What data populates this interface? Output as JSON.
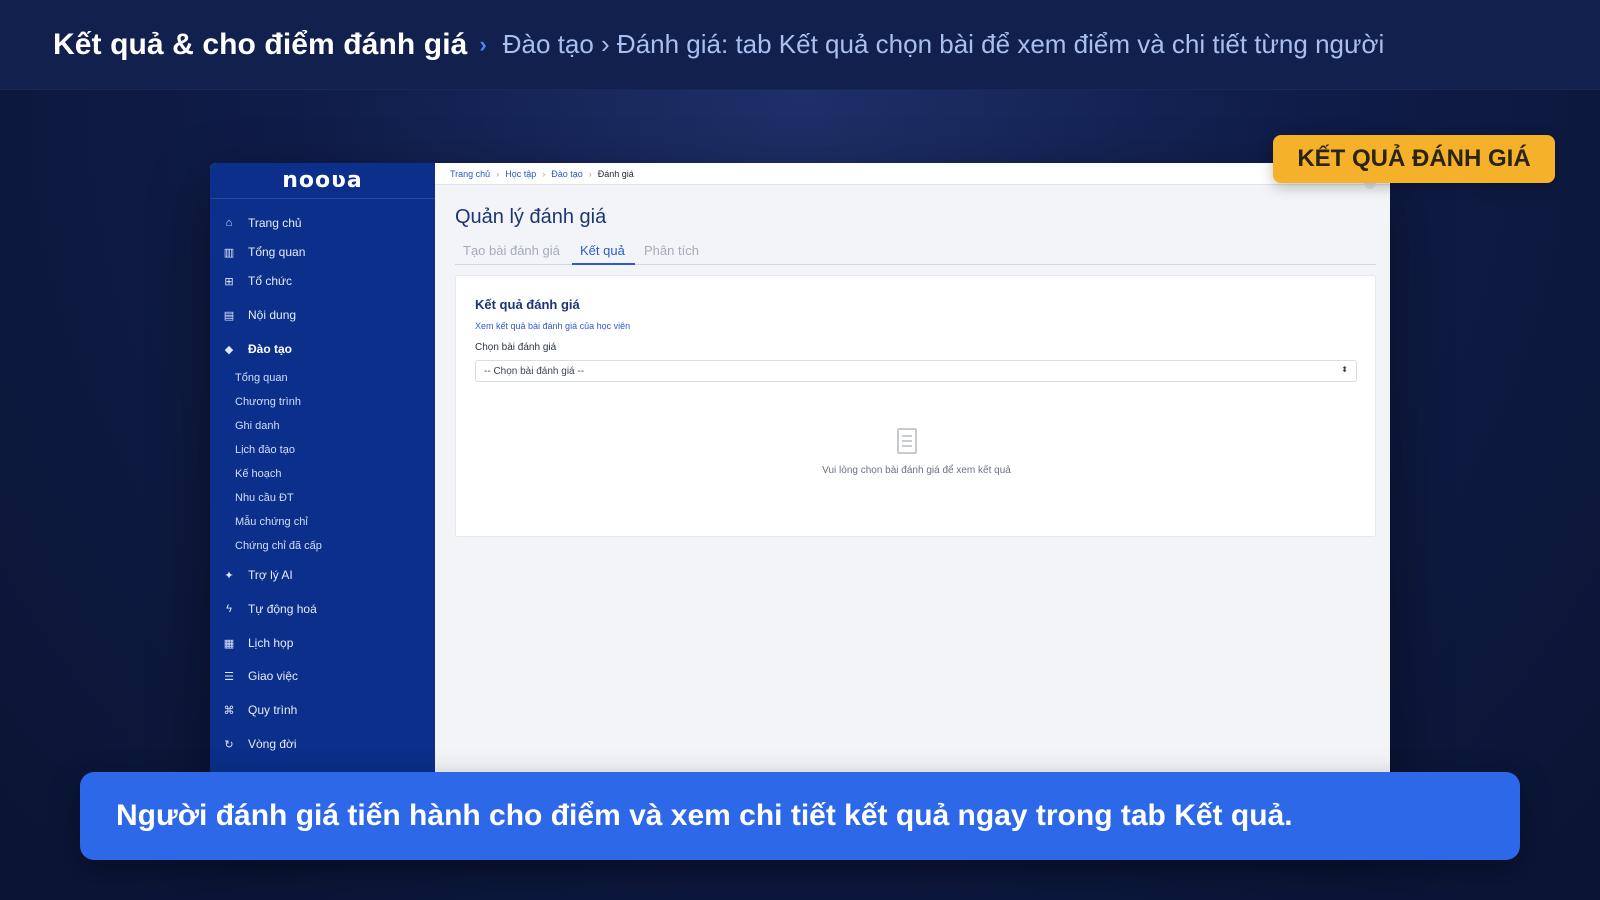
{
  "header": {
    "title": "Kết quả & cho điểm đánh giá",
    "separator": "›",
    "subtitle": "Đào tạo › Đánh giá: tab Kết quả chọn bài để xem điểm và chi tiết từng người"
  },
  "badge": {
    "label": "KẾT QUẢ ĐÁNH GIÁ",
    "color": "#f6b12a"
  },
  "caption": {
    "text": "Người đánh giá tiến hành cho điểm và xem chi tiết kết quả ngay trong tab Kết quả."
  },
  "app": {
    "logo": "nooʋa",
    "sidebar": {
      "items": [
        {
          "label": "Trang chủ",
          "icon": "home-icon"
        },
        {
          "label": "Tổng quan",
          "icon": "bar-chart-icon"
        },
        {
          "label": "Tổ chức",
          "icon": "org-chart-icon"
        },
        {
          "label": "Nội dung",
          "icon": "book-icon"
        },
        {
          "label": "Đào tạo",
          "icon": "graduation-cap-icon",
          "active": true
        },
        {
          "label": "Trợ lý AI",
          "icon": "sparkle-icon"
        },
        {
          "label": "Tự động hoá",
          "icon": "bolt-icon"
        },
        {
          "label": "Lịch họp",
          "icon": "calendar-icon"
        },
        {
          "label": "Giao việc",
          "icon": "tasks-icon"
        },
        {
          "label": "Quy trình",
          "icon": "workflow-icon"
        },
        {
          "label": "Vòng đời",
          "icon": "refresh-icon"
        }
      ],
      "sub_items": [
        "Tổng quan",
        "Chương trình",
        "Ghi danh",
        "Lịch đào tạo",
        "Kế hoạch",
        "Nhu cầu ĐT",
        "Mẫu chứng chỉ",
        "Chứng chỉ đã cấp"
      ]
    },
    "breadcrumb": [
      "Trang chủ",
      "Học tập",
      "Đào tạo",
      "Đánh giá"
    ],
    "page_title": "Quản lý đánh giá",
    "tabs": [
      {
        "label": "Tạo bài đánh giá",
        "active": false
      },
      {
        "label": "Kết quả",
        "active": true
      },
      {
        "label": "Phân tích",
        "active": false
      }
    ],
    "card": {
      "title": "Kết quả đánh giá",
      "description": "Xem kết quả bài đánh giá của học viên",
      "select_label": "Chọn bài đánh giá",
      "select_value": "-- Chọn bài đánh giá --",
      "empty_text": "Vui lòng chọn bài đánh giá để xem kết quả"
    }
  }
}
